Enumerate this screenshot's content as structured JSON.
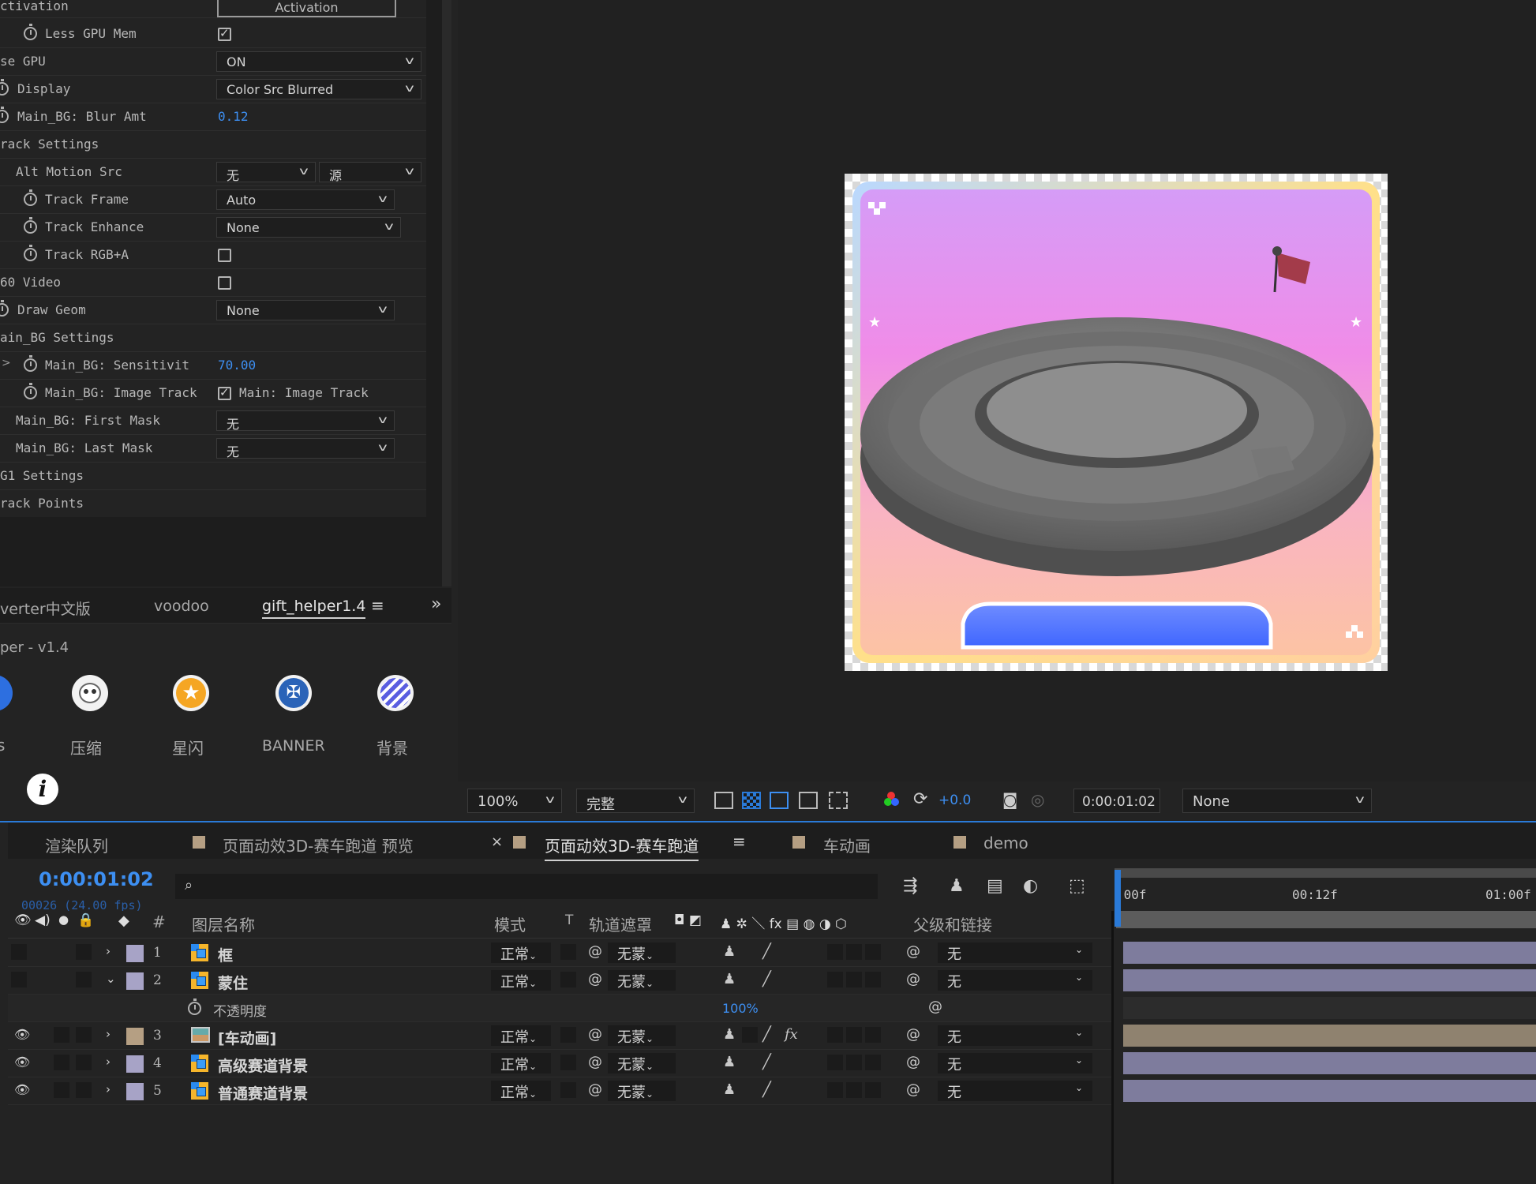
{
  "effects": {
    "activation_label": "ctivation",
    "activation_button": "Activation",
    "rows": [
      {
        "label": "Less GPU Mem"
      },
      {
        "label": "se GPU",
        "value": "ON"
      },
      {
        "label": "Display",
        "value": "Color Src Blurred"
      },
      {
        "label": "Main_BG: Blur Amt",
        "value": "0.12"
      },
      {
        "label": "rack Settings"
      },
      {
        "label": "Alt Motion Src",
        "value": "无",
        "value2": "源"
      },
      {
        "label": "Track Frame",
        "value": "Auto"
      },
      {
        "label": "Track Enhance",
        "value": "None"
      },
      {
        "label": "Track RGB+A"
      },
      {
        "label": "60 Video"
      },
      {
        "label": "Draw Geom",
        "value": "None"
      },
      {
        "label": "ain_BG Settings"
      },
      {
        "label": "Main_BG: Sensitivit",
        "value": "70.00"
      },
      {
        "label": "Main_BG: Image Track",
        "value": "Main: Image Track"
      },
      {
        "label": "Main_BG: First Mask",
        "value": "无"
      },
      {
        "label": "Main_BG: Last Mask",
        "value": "无"
      },
      {
        "label": "G1 Settings"
      },
      {
        "label": "rack Points"
      }
    ]
  },
  "gift": {
    "tabs": [
      "verter中文版",
      "voodoo",
      "gift_helper1.4"
    ],
    "title": "per - v1.4",
    "tools": [
      "s",
      "压缩",
      "星闪",
      "BANNER",
      "背景"
    ]
  },
  "viewer": {
    "zoom": "100%",
    "quality": "完整",
    "exposure": "+0.0",
    "timecode": "0:00:01:02",
    "view": "None"
  },
  "timeline": {
    "tabs": [
      "渲染队列",
      "页面动效3D-赛车跑道 预览",
      "页面动效3D-赛车跑道",
      "车动画",
      "demo"
    ],
    "close_glyph": "×",
    "timecode": "0:00:01:02",
    "frames": "00026 (24.00 fps)",
    "search_placeholder": "",
    "ruler": [
      ":00f",
      "00:12f",
      "01:00f"
    ],
    "headers": {
      "hash": "#",
      "layer_name": "图层名称",
      "mode": "模式",
      "t": "T",
      "track_matte": "轨道遮罩",
      "parent": "父级和链接"
    },
    "layers": [
      {
        "num": "1",
        "name": "框",
        "mode": "正常",
        "matte": "无蒙",
        "parent": "无",
        "label_color": "#a7a3c6"
      },
      {
        "num": "2",
        "name": "蒙住",
        "mode": "正常",
        "matte": "无蒙",
        "parent": "无",
        "label_color": "#a7a3c6"
      },
      {
        "num": "3",
        "name": "[车动画]",
        "mode": "正常",
        "matte": "无蒙",
        "parent": "无",
        "label_color": "#b59f83"
      },
      {
        "num": "4",
        "name": "高级赛道背景",
        "mode": "正常",
        "matte": "无蒙",
        "parent": "无",
        "label_color": "#a7a3c6"
      },
      {
        "num": "5",
        "name": "普通赛道背景",
        "mode": "正常",
        "matte": "无蒙",
        "parent": "无",
        "label_color": "#a7a3c6"
      }
    ],
    "opacity_label": "不透明度",
    "opacity_value": "100%"
  }
}
